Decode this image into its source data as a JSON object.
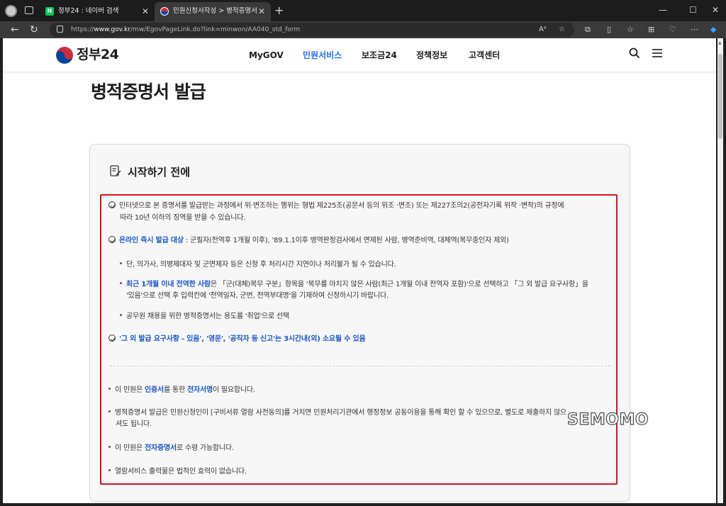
{
  "browser": {
    "tabs": [
      {
        "title": "정부24 : 네이버 검색",
        "favicon_color": "#03c75a",
        "favicon_letter": "N"
      },
      {
        "title": "민원신청서작성 > 병적증명서 발...",
        "favicon_color": "#1a3a7a"
      }
    ],
    "url_prefix": "https://",
    "url_host": "www.gov.kr",
    "url_path": "/mw/EgovPageLink.do?link=minwon/AA040_std_form"
  },
  "site": {
    "logo": "정부24",
    "nav": [
      "MyGOV",
      "민원서비스",
      "보조금24",
      "정책정보",
      "고객센터"
    ],
    "active_nav": "민원서비스"
  },
  "page": {
    "title": "병적증명서 발급",
    "card_title": "시작하기 전에",
    "notice": {
      "line1a": "인터넷으로 본 증명서를 발급받는 과정에서 위·변조하는 행위는 형법 제225조(공문서 등의 위조 ·변조) 또는 제227조의2(공전자기록 위작 ·변작)의 규정에",
      "line1b": "따라 10년 이하의 징역을 받을 수 있습니다.",
      "line2_blue": "온라인 즉시 발급 대상",
      "line2_rest": " : 군필자(전역후 1개월 이후), '89.1.1이후 병역판정검사에서 면제된 사람, 병역준비역, 대체역(복무중인자 제외)",
      "sub1": "단, 의가사, 의병제대자 및 군면제자 등은 신청 후 처리시간 지연이나 처리불가 될 수 있습니다.",
      "sub2_blue": "최근 1개월 이내 전역한 사람",
      "sub2_rest_a": "은 「군(대체)복무 구분」항목을 '복무를 마치지 않은 사람(최근 1개월 이내 전역자 포함)'으로 선택하고 「그 외 발급 요구사항」을",
      "sub2_rest_b": "'있음'으로 선택 후 입력칸에 '전역일자, 군번, 전역부대명'을 기재하여 신청하시기 바랍니다.",
      "sub3": "공무원 채용을 위한 병적증명서는 용도를 '취업'으로 선택",
      "line3_blue": "'그 외 발급 요구사항 - 있음', '영문', '공직자 등 신고'는 3시간내(외) 소요될 수 있음",
      "b1_pre": "이 민원은 ",
      "b1_blue1": "인증서",
      "b1_mid": "를 통한 ",
      "b1_blue2": "전자서명",
      "b1_post": "이 필요합니다.",
      "b2a": "병적증명서 발급은 민원신청인이 [구비서류 열람 사전동의]를 거치면 민원처리기관에서 행정정보 공동이용을 통해 확인 할 수 있으므로, 별도로 제출하지 않으",
      "b2b": "셔도 됩니다.",
      "b3_pre": "이 민원은 ",
      "b3_blue": "전자증명서",
      "b3_post": "로 수령 가능합니다.",
      "b4": "열람서비스 출력물은 법적인 효력이 없습니다."
    }
  },
  "watermark": "SEMOMO",
  "colors": {
    "accent": "#256ef4",
    "link_blue": "#1c56c6",
    "highlight_red": "#e0101c"
  }
}
